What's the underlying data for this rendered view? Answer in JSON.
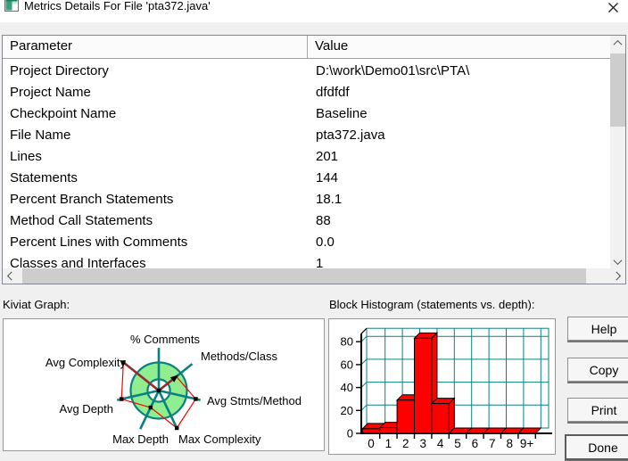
{
  "window": {
    "title": "Metrics Details For File 'pta372.java'"
  },
  "table": {
    "columns": [
      "Parameter",
      "Value"
    ],
    "rows": [
      {
        "param": "Project Directory",
        "value": "D:\\work\\Demo01\\src\\PTA\\"
      },
      {
        "param": "Project Name",
        "value": "dfdfdf"
      },
      {
        "param": "Checkpoint Name",
        "value": "Baseline"
      },
      {
        "param": "File Name",
        "value": "pta372.java"
      },
      {
        "param": "Lines",
        "value": "201"
      },
      {
        "param": "Statements",
        "value": "144"
      },
      {
        "param": "Percent Branch Statements",
        "value": "18.1"
      },
      {
        "param": "Method Call Statements",
        "value": "88"
      },
      {
        "param": "Percent Lines with Comments",
        "value": "0.0"
      },
      {
        "param": "Classes and Interfaces",
        "value": "1"
      }
    ]
  },
  "sections": {
    "kiviat_label": "Kiviat Graph:",
    "histogram_label": "Block Histogram (statements vs. depth):"
  },
  "buttons": {
    "help": "Help",
    "copy": "Copy",
    "print": "Print",
    "done": "Done"
  },
  "chart_data": [
    {
      "type": "radar",
      "title": "Kiviat Graph",
      "axes": [
        "% Comments",
        "Methods/Class",
        "Avg Stmts/Method",
        "Max Complexity",
        "Max Depth",
        "Avg Depth",
        "Avg Complexity"
      ],
      "values_fraction_of_outer_ring": [
        0.0,
        0.8,
        1.35,
        1.48,
        0.67,
        1.36,
        1.61
      ],
      "ring": {
        "inner_fraction": 0.4,
        "outer_fraction": 1.0,
        "spoke_fraction": 1.52,
        "band_color": "#90ee90"
      },
      "line_color": "#ff0000",
      "center_edge_color": "#9b2b2b",
      "axis_color": "#0a8080",
      "legend_position": "none"
    },
    {
      "type": "bar",
      "title": "Block Histogram (statements vs. depth)",
      "categories": [
        "0",
        "1",
        "2",
        "3",
        "4",
        "5",
        "6",
        "7",
        "8",
        "9+"
      ],
      "values": [
        4,
        5,
        29,
        83,
        26,
        0,
        0,
        0,
        0,
        0
      ],
      "xlabel": "depth",
      "ylabel": "statements",
      "yticks": [
        0,
        20,
        40,
        60,
        80
      ],
      "ylim": [
        0,
        87
      ],
      "grid": true,
      "grid_color": "#0a8080",
      "bar_color": "#ff0000",
      "style": "3d"
    }
  ],
  "colors": {
    "dialog_bg": "#f0f0f0",
    "titlebar_bg": "#ffffff",
    "teal": "#0a8080",
    "ring_green": "#90ee90",
    "bar_red": "#ff0000",
    "dark_red": "#9b2b2b",
    "scroll_thumb": "#cdcdcd"
  }
}
